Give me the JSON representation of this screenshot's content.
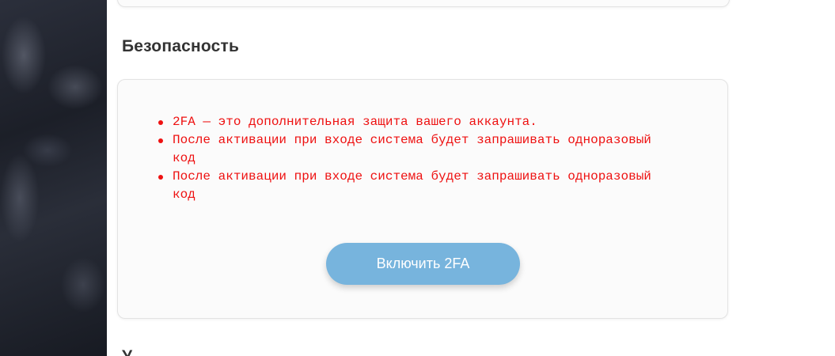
{
  "security": {
    "title": "Безопасность",
    "info": [
      "2FA — это дополнительная защита вашего аккаунта.",
      "После активации при входе система будет запрашивать одноразовый код",
      "После активации при входе система будет запрашивать одноразовый код"
    ],
    "enable_button_label": "Включить 2FA"
  },
  "next_section": {
    "title_partial": "У"
  },
  "colors": {
    "accent_button": "#77b4dd",
    "info_text": "#ee1111",
    "heading": "#333333"
  }
}
